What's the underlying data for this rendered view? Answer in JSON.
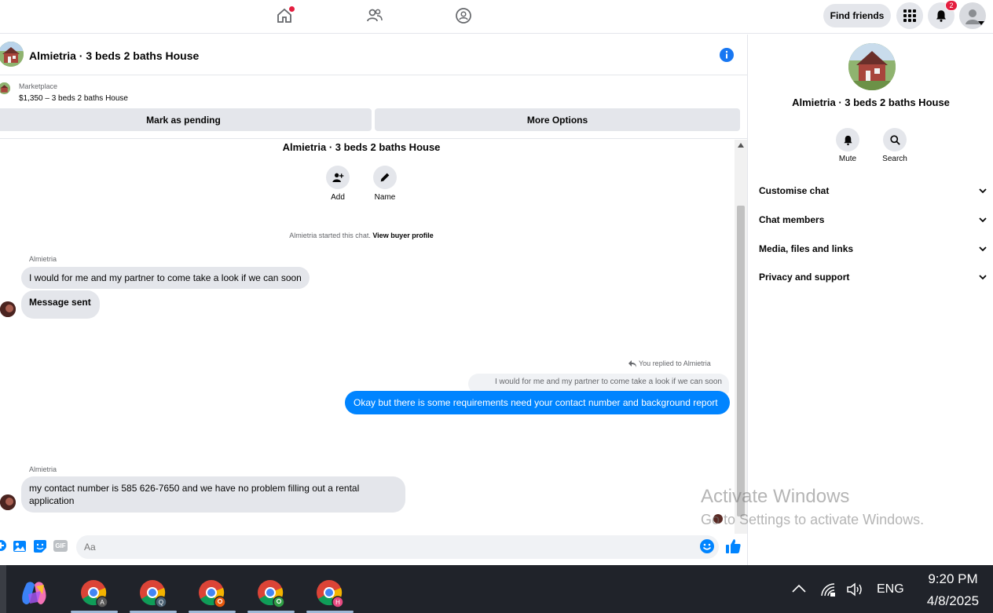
{
  "nav": {
    "find_friends": "Find friends",
    "notification_count": "2"
  },
  "chat": {
    "title": "Almietria · 3 beds 2 baths House",
    "marketplace_label": "Marketplace",
    "listing": "$1,350 – 3 beds 2 baths House",
    "mark_pending": "Mark as pending",
    "more_options": "More Options"
  },
  "conversation": {
    "title": "Almietria · 3 beds 2 baths House",
    "add_label": "Add",
    "name_label": "Name",
    "started_text": "Almietria started this chat.",
    "view_profile": "View buyer profile",
    "sender1": "Almietria",
    "msg1": "I would for me and my partner to come take a look if we can soon",
    "msg2": "Message sent",
    "replied_label": "You replied to Almietria",
    "quoted": "I would for me and my partner to come take a look if we can soon",
    "reply": "Okay but there is some requirements need your contact number and background report",
    "sender2": "Almietria",
    "msg3": "my contact number is 585 626-7650 and we have no problem filling out a rental application"
  },
  "composer": {
    "placeholder": "Aa"
  },
  "right_panel": {
    "title": "Almietria · 3 beds 2 baths House",
    "mute": "Mute",
    "search": "Search",
    "sections": [
      "Customise chat",
      "Chat members",
      "Media, files and links",
      "Privacy and support"
    ]
  },
  "watermark": {
    "line1": "Activate Windows",
    "line2": "Go to Settings to activate Windows."
  },
  "taskbar": {
    "apps": [
      "copilot",
      "chrome-a",
      "chrome-q",
      "chrome-profile-1",
      "chrome-profile-2",
      "chrome-h"
    ],
    "chrome_badges": [
      "A",
      "Q",
      "",
      "",
      "H"
    ],
    "language": "ENG",
    "time": "9:20 PM",
    "date": "4/8/2025"
  },
  "colors": {
    "messenger_blue": "#0084ff",
    "facebook_blue": "#1877f2",
    "bubble_grey": "#e4e6eb"
  }
}
